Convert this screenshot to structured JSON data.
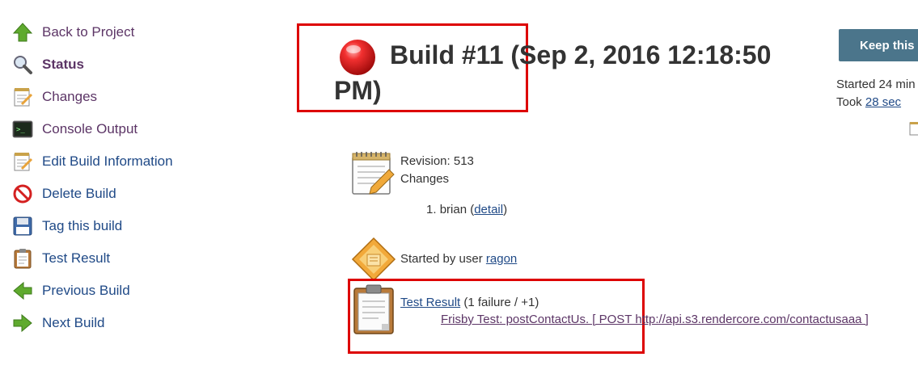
{
  "sidebar": {
    "items": [
      {
        "label": "Back to Project",
        "icon": "up-arrow-icon"
      },
      {
        "label": "Status",
        "icon": "magnifier-icon"
      },
      {
        "label": "Changes",
        "icon": "notepad-icon"
      },
      {
        "label": "Console Output",
        "icon": "terminal-icon"
      },
      {
        "label": "Edit Build Information",
        "icon": "notepad-icon"
      },
      {
        "label": "Delete Build",
        "icon": "no-entry-icon"
      },
      {
        "label": "Tag this build",
        "icon": "floppy-disk-icon"
      },
      {
        "label": "Test Result",
        "icon": "clipboard-icon"
      },
      {
        "label": "Previous Build",
        "icon": "left-arrow-icon"
      },
      {
        "label": "Next Build",
        "icon": "right-arrow-icon"
      }
    ]
  },
  "build": {
    "title_line1": "Build #11 (Sep 2, 2016 12:18:50",
    "title_line2": "PM)",
    "status_color": "#e01b1b"
  },
  "right": {
    "keep_label": "Keep this",
    "started_text": "Started 24 min",
    "took_prefix": "Took ",
    "took_link": "28 sec"
  },
  "changes": {
    "revision": "Revision: 513",
    "label": "Changes",
    "entry_number": "1.",
    "entry_author": "brian",
    "entry_open": " (",
    "entry_detail": "detail",
    "entry_close": ")"
  },
  "cause": {
    "prefix": "Started by user ",
    "user": "ragon"
  },
  "tests": {
    "link": "Test Result",
    "summary": " (1 failure / +1)",
    "failure": "Frisby Test: postContactUs. [ POST http://api.s3.rendercore.com/contactusaaa ]"
  },
  "colors": {
    "link": "#204a87",
    "visited": "#5c3566",
    "highlight": "#dd0000",
    "button": "#4b758b"
  }
}
